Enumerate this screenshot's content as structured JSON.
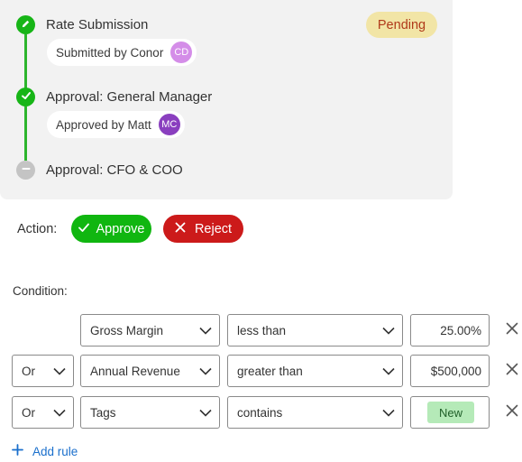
{
  "status_badge": "Pending",
  "steps": [
    {
      "title": "Rate Submission",
      "chip_text": "Submitted by Conor",
      "avatar_initials": "CD",
      "avatar_color": "#d48de8",
      "state": "done",
      "icon": "pencil-icon"
    },
    {
      "title": "Approval: General Manager",
      "chip_text": "Approved by Matt",
      "avatar_initials": "MC",
      "avatar_color": "#8a3fbf",
      "state": "done",
      "icon": "check-icon"
    },
    {
      "title": "Approval: CFO & COO",
      "state": "pending",
      "icon": "minus-icon"
    }
  ],
  "action": {
    "label": "Action:",
    "approve_label": "Approve",
    "reject_label": "Reject"
  },
  "condition": {
    "label": "Condition:",
    "rules": [
      {
        "field": "Gross Margin",
        "operator": "less than",
        "value": "25.00%"
      },
      {
        "conjunction": "Or",
        "field": "Annual Revenue",
        "operator": "greater than",
        "value": "$500,000"
      },
      {
        "conjunction": "Or",
        "field": "Tags",
        "operator": "contains",
        "tag": "New"
      }
    ],
    "add_rule_label": "Add rule"
  },
  "colors": {
    "done_green": "#17b517",
    "pending_gray": "#c4c4c4",
    "approve_green": "#10b610",
    "reject_red": "#cc1a1a",
    "link_blue": "#1a6fcc",
    "badge_bg": "#f2e5a6",
    "badge_text": "#b03a1a"
  }
}
